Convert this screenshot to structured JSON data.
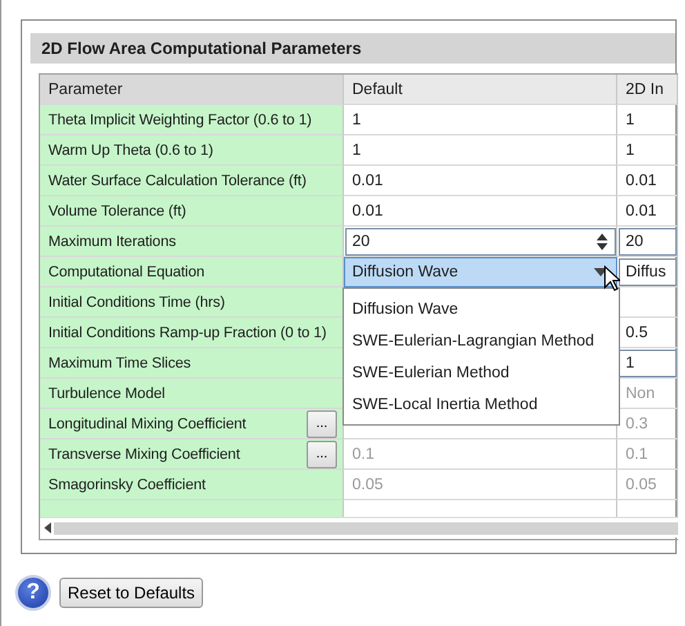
{
  "panel": {
    "title": "2D Flow Area Computational Parameters"
  },
  "table": {
    "columns": [
      "Parameter",
      "Default",
      "2D In"
    ],
    "rows": [
      {
        "parameter": "Theta Implicit Weighting Factor (0.6 to 1)",
        "default": {
          "kind": "text",
          "value": "1"
        },
        "column_3": {
          "kind": "text",
          "value": "1"
        }
      },
      {
        "parameter": "Warm Up Theta (0.6 to 1)",
        "default": {
          "kind": "text",
          "value": "1"
        },
        "column_3": {
          "kind": "text",
          "value": "1"
        }
      },
      {
        "parameter": "Water Surface Calculation Tolerance (ft)",
        "default": {
          "kind": "text",
          "value": "0.01"
        },
        "column_3": {
          "kind": "text",
          "value": "0.01"
        }
      },
      {
        "parameter": "Volume Tolerance (ft)",
        "default": {
          "kind": "text",
          "value": "0.01"
        },
        "column_3": {
          "kind": "text",
          "value": "0.01"
        }
      },
      {
        "parameter": "Maximum Iterations",
        "default": {
          "kind": "spin",
          "value": "20"
        },
        "column_3": {
          "kind": "box",
          "value": "20"
        }
      },
      {
        "parameter": "Computational Equation",
        "default": {
          "kind": "combo",
          "value": "Diffusion Wave",
          "expanded": true
        },
        "column_3": {
          "kind": "box",
          "value": "Diffus"
        }
      },
      {
        "parameter": "Initial Conditions Time (hrs)",
        "default": {
          "kind": "hidden"
        },
        "column_3": {
          "kind": "empty"
        }
      },
      {
        "parameter": "Initial Conditions Ramp-up Fraction (0 to 1)",
        "default": {
          "kind": "hidden"
        },
        "column_3": {
          "kind": "text",
          "value": "0.5"
        }
      },
      {
        "parameter": "Maximum Time Slices",
        "default": {
          "kind": "hidden"
        },
        "column_3": {
          "kind": "box",
          "value": "1"
        }
      },
      {
        "parameter": "Turbulence Model",
        "default": {
          "kind": "hidden"
        },
        "column_3": {
          "kind": "text",
          "value": "Non",
          "disabled": true
        }
      },
      {
        "parameter": "Longitudinal Mixing Coefficient",
        "ellipsis": "...",
        "default": {
          "kind": "empty"
        },
        "column_3": {
          "kind": "text",
          "value": "0.3",
          "disabled": true
        }
      },
      {
        "parameter": "Transverse Mixing Coefficient",
        "ellipsis": "...",
        "default": {
          "kind": "text",
          "value": "0.1",
          "disabled": true
        },
        "column_3": {
          "kind": "text",
          "value": "0.1",
          "disabled": true
        }
      },
      {
        "parameter": "Smagorinsky Coefficient",
        "default": {
          "kind": "text",
          "value": "0.05",
          "disabled": true
        },
        "column_3": {
          "kind": "text",
          "value": "0.05",
          "disabled": true
        }
      }
    ],
    "dropdown": {
      "options": [
        "Diffusion Wave",
        "SWE-Eulerian-Lagrangian Method",
        "SWE-Eulerian Method",
        "SWE-Local Inertia Method"
      ]
    }
  },
  "footer": {
    "help": "?",
    "button": "Reset to Defaults"
  }
}
